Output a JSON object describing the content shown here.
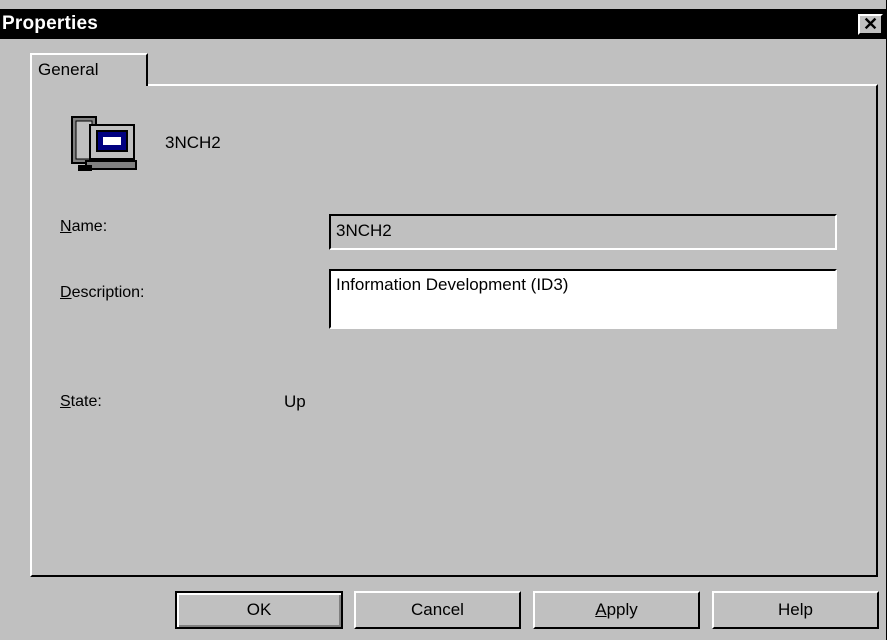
{
  "window": {
    "title": "Properties",
    "close_symbol": "✕"
  },
  "tabs": [
    {
      "label": "General",
      "active": true
    }
  ],
  "general": {
    "icon": "computer-icon",
    "header_name": "3NCH2",
    "name_label": "Name:",
    "name_value": "3NCH2",
    "description_label": "Description:",
    "description_value": "Information Development (ID3)",
    "state_label": "State:",
    "state_value": "Up"
  },
  "buttons": {
    "ok": "OK",
    "cancel": "Cancel",
    "apply": "Apply",
    "help": "Help"
  },
  "colors": {
    "face": "#c0c0c0",
    "titlebar": "#000000",
    "field_bg": "#ffffff"
  }
}
